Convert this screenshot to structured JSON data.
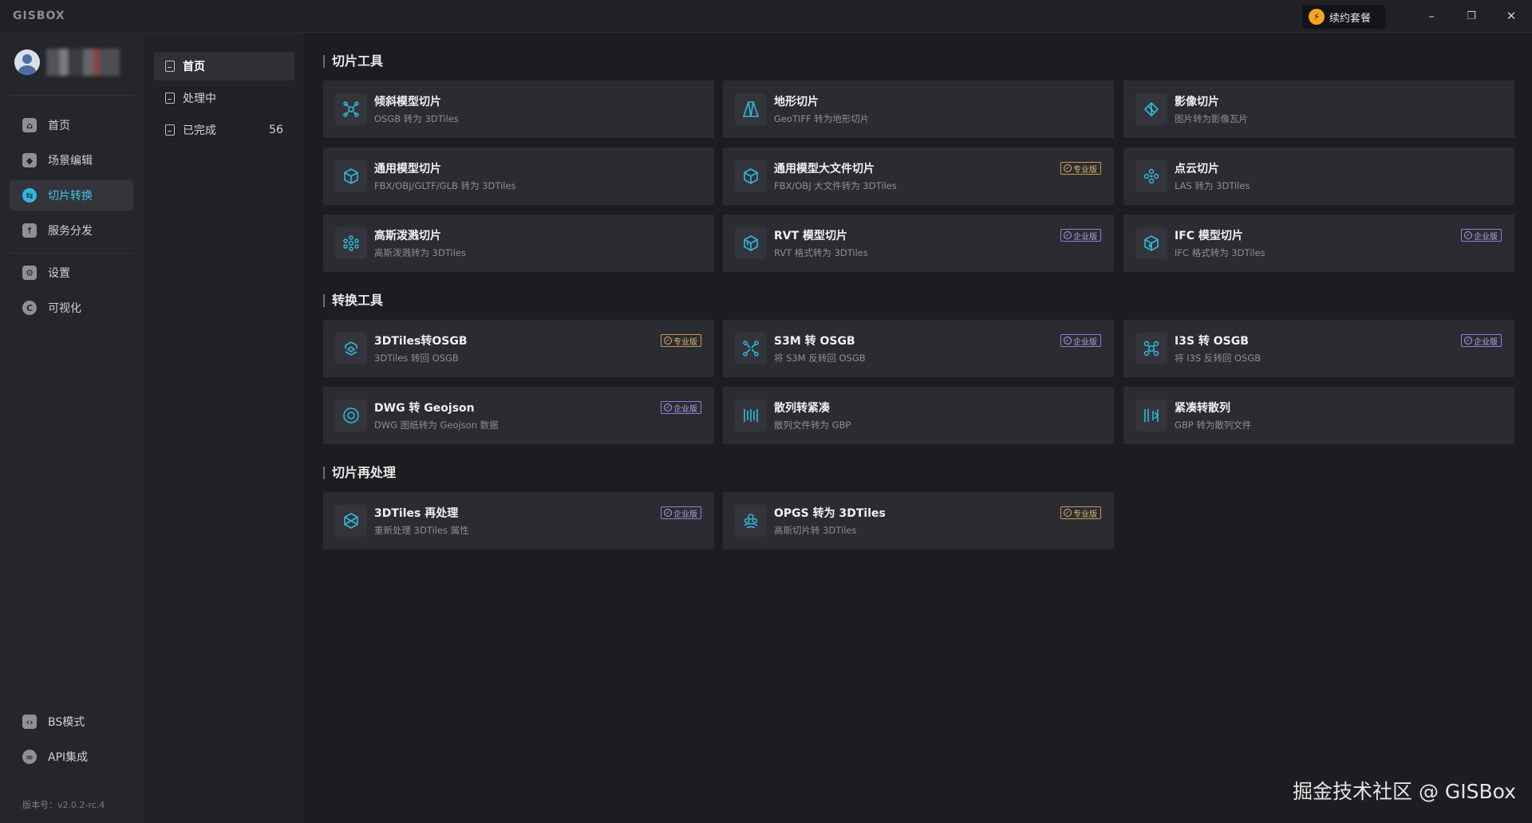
{
  "app": {
    "logo": "GISBOX",
    "renew_label": "续约套餐"
  },
  "window_controls": {
    "minimize": "–",
    "restore": "❐",
    "close": "✕"
  },
  "sidebar": {
    "items": [
      {
        "label": "首页",
        "icon": "home-icon"
      },
      {
        "label": "场景编辑",
        "icon": "cube-icon"
      },
      {
        "label": "切片转换",
        "icon": "convert-icon",
        "active": true
      },
      {
        "label": "服务分发",
        "icon": "upload-icon"
      },
      {
        "label": "设置",
        "icon": "gear-icon"
      },
      {
        "label": "可视化",
        "icon": "visual-icon"
      },
      {
        "label": "BS模式",
        "icon": "code-icon"
      },
      {
        "label": "API集成",
        "icon": "api-icon"
      }
    ],
    "version": "版本号：v2.0.2-rc.4"
  },
  "subnav": {
    "items": [
      {
        "label": "首页",
        "active": true
      },
      {
        "label": "处理中"
      },
      {
        "label": "已完成",
        "count": "56"
      }
    ]
  },
  "sections": [
    {
      "title": "切片工具",
      "cards": [
        {
          "title": "倾斜模型切片",
          "subtitle": "OSGB 转为 3DTiles",
          "badge": ""
        },
        {
          "title": "地形切片",
          "subtitle": "GeoTIFF 转为地形切片",
          "badge": ""
        },
        {
          "title": "影像切片",
          "subtitle": "图片转为影像瓦片",
          "badge": ""
        },
        {
          "title": "通用模型切片",
          "subtitle": "FBX/OBJ/GLTF/GLB 转为 3DTiles",
          "badge": ""
        },
        {
          "title": "通用模型大文件切片",
          "subtitle": "FBX/OBJ 大文件转为 3DTiles",
          "badge": "专业版"
        },
        {
          "title": "点云切片",
          "subtitle": "LAS 转为 3DTiles",
          "badge": ""
        },
        {
          "title": "高斯泼溅切片",
          "subtitle": "高斯泼溅转为 3DTiles",
          "badge": ""
        },
        {
          "title": "RVT 模型切片",
          "subtitle": "RVT 格式转为 3DTiles",
          "badge": "企业版"
        },
        {
          "title": "IFC 模型切片",
          "subtitle": "IFC 格式转为 3DTiles",
          "badge": "企业版"
        }
      ]
    },
    {
      "title": "转换工具",
      "cards": [
        {
          "title": "3DTiles转OSGB",
          "subtitle": "3DTiles 转回 OSGB",
          "badge": "专业版"
        },
        {
          "title": "S3M 转 OSGB",
          "subtitle": "将 S3M 反转回 OSGB",
          "badge": "企业版"
        },
        {
          "title": "I3S 转 OSGB",
          "subtitle": "将 I3S 反转回 OSGB",
          "badge": "企业版"
        },
        {
          "title": "DWG 转 Geojson",
          "subtitle": "DWG 图纸转为 Geojson 数据",
          "badge": "企业版"
        },
        {
          "title": "散列转紧凑",
          "subtitle": "散列文件转为 GBP",
          "badge": ""
        },
        {
          "title": "紧凑转散列",
          "subtitle": "GBP 转为散列文件",
          "badge": ""
        }
      ]
    },
    {
      "title": "切片再处理",
      "cards": [
        {
          "title": "3DTiles 再处理",
          "subtitle": "重新处理 3DTiles 属性",
          "badge": "企业版"
        },
        {
          "title": "OPGS 转为 3DTiles",
          "subtitle": "高斯切片转 3DTiles",
          "badge": "专业版"
        }
      ]
    }
  ],
  "watermark": "掘金技术社区 @ GISBox",
  "colors": {
    "accent": "#2fb8dd",
    "pro_badge": "#e0b66b",
    "enterprise_badge": "#aea4f0",
    "background": "#1c1d21"
  }
}
